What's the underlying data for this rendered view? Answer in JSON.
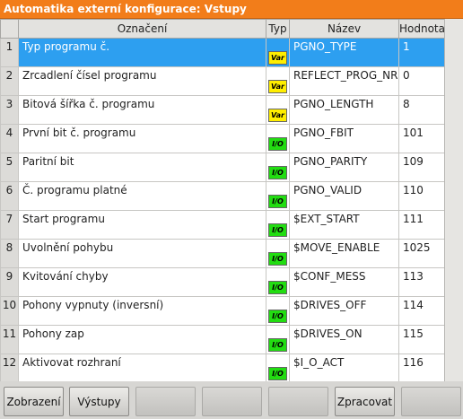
{
  "window": {
    "title": "Automatika externí konfigurace: Vstupy"
  },
  "table": {
    "headers": {
      "index": "",
      "label": "Označení",
      "type": "Typ",
      "name": "Název",
      "value": "Hodnota"
    },
    "rows": [
      {
        "index": "1",
        "label": "Typ programu č.",
        "type": "var",
        "type_text": "Var",
        "name": "PGNO_TYPE",
        "value": "1"
      },
      {
        "index": "2",
        "label": "Zrcadlení čísel programu",
        "type": "var",
        "type_text": "Var",
        "name": "REFLECT_PROG_NR",
        "value": "0"
      },
      {
        "index": "3",
        "label": "Bitová šířka č. programu",
        "type": "var",
        "type_text": "Var",
        "name": "PGNO_LENGTH",
        "value": "8"
      },
      {
        "index": "4",
        "label": "První bit č. programu",
        "type": "io",
        "type_text": "I/O",
        "name": "PGNO_FBIT",
        "value": "101"
      },
      {
        "index": "5",
        "label": "Paritní bit",
        "type": "io",
        "type_text": "I/O",
        "name": "PGNO_PARITY",
        "value": "109"
      },
      {
        "index": "6",
        "label": "Č. programu platné",
        "type": "io",
        "type_text": "I/O",
        "name": "PGNO_VALID",
        "value": "110"
      },
      {
        "index": "7",
        "label": "Start programu",
        "type": "io",
        "type_text": "I/O",
        "name": "$EXT_START",
        "value": "111"
      },
      {
        "index": "8",
        "label": "Uvolnění pohybu",
        "type": "io",
        "type_text": "I/O",
        "name": "$MOVE_ENABLE",
        "value": "1025"
      },
      {
        "index": "9",
        "label": "Kvitování chyby",
        "type": "io",
        "type_text": "I/O",
        "name": "$CONF_MESS",
        "value": "113"
      },
      {
        "index": "10",
        "label": "Pohony vypnuty (inversní)",
        "type": "io",
        "type_text": "I/O",
        "name": "$DRIVES_OFF",
        "value": "114"
      },
      {
        "index": "11",
        "label": "Pohony zap",
        "type": "io",
        "type_text": "I/O",
        "name": "$DRIVES_ON",
        "value": "115"
      },
      {
        "index": "12",
        "label": "Aktivovat rozhraní",
        "type": "io",
        "type_text": "I/O",
        "name": "$I_O_ACT",
        "value": "116"
      }
    ],
    "selected_row": 1
  },
  "softkeys": {
    "k1": "Zobrazení",
    "k2": "Výstupy",
    "k3": "",
    "k4": "",
    "k5": "",
    "k6": "Zpracovat",
    "k7": ""
  },
  "colors": {
    "title_bar": "#f27d1a",
    "selection": "#2d9ff0",
    "var_badge": "#ffee00",
    "io_badge": "#22dd11"
  }
}
